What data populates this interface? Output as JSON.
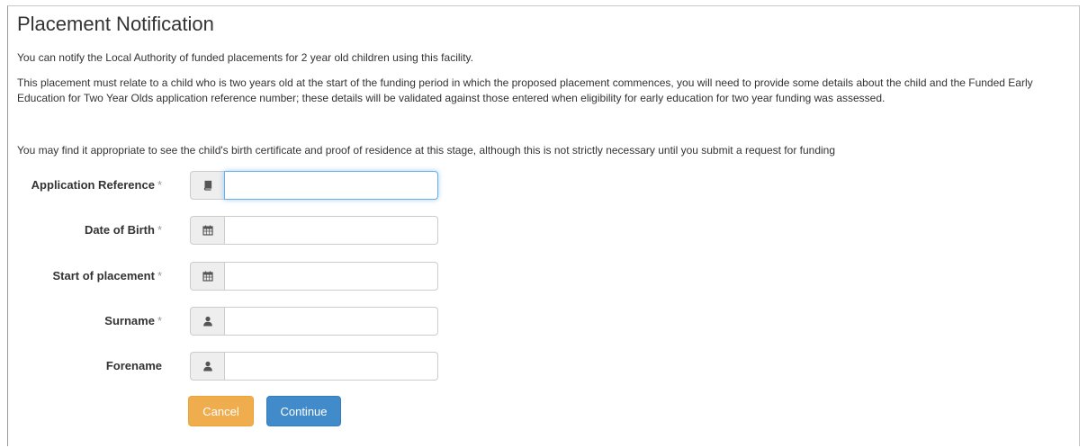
{
  "page": {
    "title": "Placement Notification",
    "intro": "You can notify the Local Authority of funded placements for 2 year old children using this facility.",
    "requirements": "This placement must relate to a child who is two years old at the start of the funding period in which the proposed placement commences, you will need to provide some details about the child and the Funded Early Education for Two Year Olds application reference number; these details will be validated against those entered when eligibility for early education for two year funding was assessed.",
    "advice": "You may find it appropriate to see the child's birth certificate and proof of residence at this stage, although this is not strictly necessary until you submit a request for funding"
  },
  "form": {
    "required_marker": "*",
    "fields": [
      {
        "label": "Application Reference",
        "required": true,
        "icon": "book-icon",
        "value": ""
      },
      {
        "label": "Date of Birth",
        "required": true,
        "icon": "calendar-icon",
        "value": ""
      },
      {
        "label": "Start of placement",
        "required": true,
        "icon": "calendar-icon",
        "value": ""
      },
      {
        "label": "Surname",
        "required": true,
        "icon": "user-icon",
        "value": ""
      },
      {
        "label": "Forename",
        "required": false,
        "icon": "user-icon",
        "value": ""
      }
    ],
    "cancel_label": "Cancel",
    "continue_label": "Continue"
  },
  "colors": {
    "cancel": "#f0ad4e",
    "continue": "#428bca",
    "focus": "#66afe9"
  }
}
